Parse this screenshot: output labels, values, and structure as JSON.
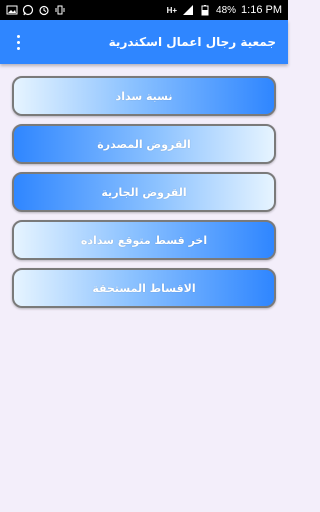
{
  "statusbar": {
    "left_icons": [
      "image-icon",
      "whatsapp-icon",
      "alarm-icon",
      "vibrate-icon"
    ],
    "network": "H+",
    "battery": "48%",
    "time": "1:16 PM"
  },
  "appbar": {
    "title": "جمعية رجال اعمال اسكندرية",
    "menu_icon": "overflow-menu-icon"
  },
  "menu": {
    "items": [
      {
        "label": "نسبة سداد"
      },
      {
        "label": "القروض المصدرة"
      },
      {
        "label": "القروض الجارية"
      },
      {
        "label": "اخر قسط متوقع سداده"
      },
      {
        "label": "الاقساط المستحقة"
      }
    ]
  }
}
